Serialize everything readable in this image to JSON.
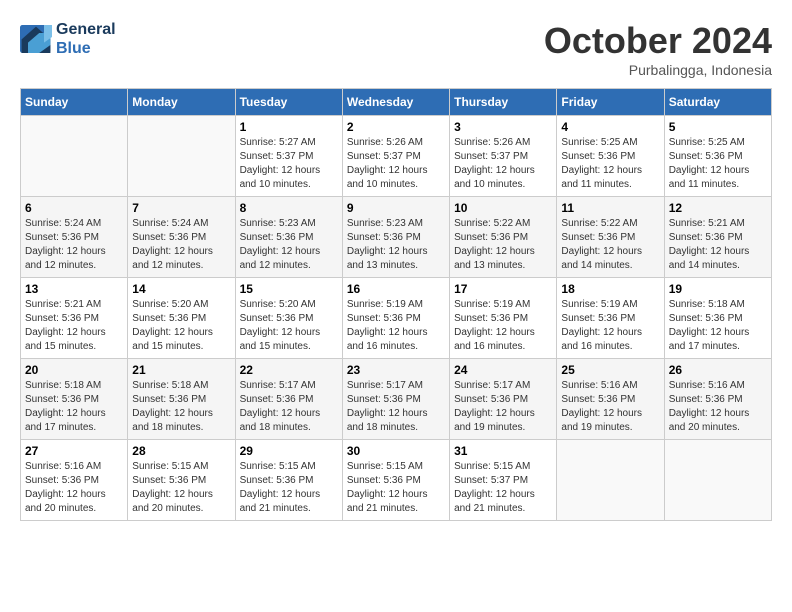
{
  "header": {
    "logo_line1": "General",
    "logo_line2": "Blue",
    "month": "October 2024",
    "location": "Purbalingga, Indonesia"
  },
  "weekdays": [
    "Sunday",
    "Monday",
    "Tuesday",
    "Wednesday",
    "Thursday",
    "Friday",
    "Saturday"
  ],
  "weeks": [
    [
      {
        "day": "",
        "info": ""
      },
      {
        "day": "",
        "info": ""
      },
      {
        "day": "1",
        "info": "Sunrise: 5:27 AM\nSunset: 5:37 PM\nDaylight: 12 hours\nand 10 minutes."
      },
      {
        "day": "2",
        "info": "Sunrise: 5:26 AM\nSunset: 5:37 PM\nDaylight: 12 hours\nand 10 minutes."
      },
      {
        "day": "3",
        "info": "Sunrise: 5:26 AM\nSunset: 5:37 PM\nDaylight: 12 hours\nand 10 minutes."
      },
      {
        "day": "4",
        "info": "Sunrise: 5:25 AM\nSunset: 5:36 PM\nDaylight: 12 hours\nand 11 minutes."
      },
      {
        "day": "5",
        "info": "Sunrise: 5:25 AM\nSunset: 5:36 PM\nDaylight: 12 hours\nand 11 minutes."
      }
    ],
    [
      {
        "day": "6",
        "info": "Sunrise: 5:24 AM\nSunset: 5:36 PM\nDaylight: 12 hours\nand 12 minutes."
      },
      {
        "day": "7",
        "info": "Sunrise: 5:24 AM\nSunset: 5:36 PM\nDaylight: 12 hours\nand 12 minutes."
      },
      {
        "day": "8",
        "info": "Sunrise: 5:23 AM\nSunset: 5:36 PM\nDaylight: 12 hours\nand 12 minutes."
      },
      {
        "day": "9",
        "info": "Sunrise: 5:23 AM\nSunset: 5:36 PM\nDaylight: 12 hours\nand 13 minutes."
      },
      {
        "day": "10",
        "info": "Sunrise: 5:22 AM\nSunset: 5:36 PM\nDaylight: 12 hours\nand 13 minutes."
      },
      {
        "day": "11",
        "info": "Sunrise: 5:22 AM\nSunset: 5:36 PM\nDaylight: 12 hours\nand 14 minutes."
      },
      {
        "day": "12",
        "info": "Sunrise: 5:21 AM\nSunset: 5:36 PM\nDaylight: 12 hours\nand 14 minutes."
      }
    ],
    [
      {
        "day": "13",
        "info": "Sunrise: 5:21 AM\nSunset: 5:36 PM\nDaylight: 12 hours\nand 15 minutes."
      },
      {
        "day": "14",
        "info": "Sunrise: 5:20 AM\nSunset: 5:36 PM\nDaylight: 12 hours\nand 15 minutes."
      },
      {
        "day": "15",
        "info": "Sunrise: 5:20 AM\nSunset: 5:36 PM\nDaylight: 12 hours\nand 15 minutes."
      },
      {
        "day": "16",
        "info": "Sunrise: 5:19 AM\nSunset: 5:36 PM\nDaylight: 12 hours\nand 16 minutes."
      },
      {
        "day": "17",
        "info": "Sunrise: 5:19 AM\nSunset: 5:36 PM\nDaylight: 12 hours\nand 16 minutes."
      },
      {
        "day": "18",
        "info": "Sunrise: 5:19 AM\nSunset: 5:36 PM\nDaylight: 12 hours\nand 16 minutes."
      },
      {
        "day": "19",
        "info": "Sunrise: 5:18 AM\nSunset: 5:36 PM\nDaylight: 12 hours\nand 17 minutes."
      }
    ],
    [
      {
        "day": "20",
        "info": "Sunrise: 5:18 AM\nSunset: 5:36 PM\nDaylight: 12 hours\nand 17 minutes."
      },
      {
        "day": "21",
        "info": "Sunrise: 5:18 AM\nSunset: 5:36 PM\nDaylight: 12 hours\nand 18 minutes."
      },
      {
        "day": "22",
        "info": "Sunrise: 5:17 AM\nSunset: 5:36 PM\nDaylight: 12 hours\nand 18 minutes."
      },
      {
        "day": "23",
        "info": "Sunrise: 5:17 AM\nSunset: 5:36 PM\nDaylight: 12 hours\nand 18 minutes."
      },
      {
        "day": "24",
        "info": "Sunrise: 5:17 AM\nSunset: 5:36 PM\nDaylight: 12 hours\nand 19 minutes."
      },
      {
        "day": "25",
        "info": "Sunrise: 5:16 AM\nSunset: 5:36 PM\nDaylight: 12 hours\nand 19 minutes."
      },
      {
        "day": "26",
        "info": "Sunrise: 5:16 AM\nSunset: 5:36 PM\nDaylight: 12 hours\nand 20 minutes."
      }
    ],
    [
      {
        "day": "27",
        "info": "Sunrise: 5:16 AM\nSunset: 5:36 PM\nDaylight: 12 hours\nand 20 minutes."
      },
      {
        "day": "28",
        "info": "Sunrise: 5:15 AM\nSunset: 5:36 PM\nDaylight: 12 hours\nand 20 minutes."
      },
      {
        "day": "29",
        "info": "Sunrise: 5:15 AM\nSunset: 5:36 PM\nDaylight: 12 hours\nand 21 minutes."
      },
      {
        "day": "30",
        "info": "Sunrise: 5:15 AM\nSunset: 5:36 PM\nDaylight: 12 hours\nand 21 minutes."
      },
      {
        "day": "31",
        "info": "Sunrise: 5:15 AM\nSunset: 5:37 PM\nDaylight: 12 hours\nand 21 minutes."
      },
      {
        "day": "",
        "info": ""
      },
      {
        "day": "",
        "info": ""
      }
    ]
  ]
}
